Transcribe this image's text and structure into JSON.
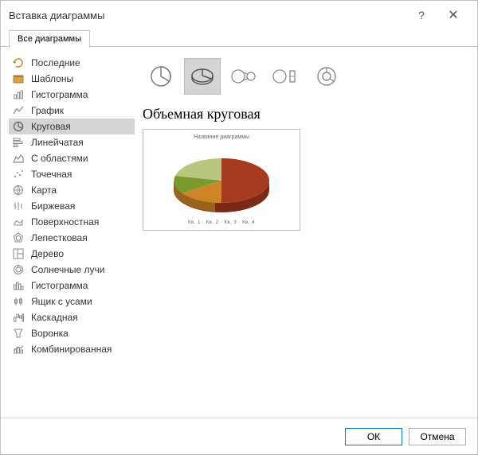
{
  "dialog": {
    "title": "Вставка диаграммы"
  },
  "tab": {
    "label": "Все диаграммы"
  },
  "sidebar": {
    "items": [
      {
        "label": "Последние",
        "icon": "recent-icon"
      },
      {
        "label": "Шаблоны",
        "icon": "templates-icon"
      },
      {
        "label": "Гистограмма",
        "icon": "column-chart-icon"
      },
      {
        "label": "График",
        "icon": "line-chart-icon"
      },
      {
        "label": "Круговая",
        "icon": "pie-chart-icon",
        "selected": true
      },
      {
        "label": "Линейчатая",
        "icon": "bar-chart-icon"
      },
      {
        "label": "С областями",
        "icon": "area-chart-icon"
      },
      {
        "label": "Точечная",
        "icon": "scatter-chart-icon"
      },
      {
        "label": "Карта",
        "icon": "map-chart-icon"
      },
      {
        "label": "Биржевая",
        "icon": "stock-chart-icon"
      },
      {
        "label": "Поверхностная",
        "icon": "surface-chart-icon"
      },
      {
        "label": "Лепестковая",
        "icon": "radar-chart-icon"
      },
      {
        "label": "Дерево",
        "icon": "treemap-chart-icon"
      },
      {
        "label": "Солнечные лучи",
        "icon": "sunburst-chart-icon"
      },
      {
        "label": "Гистограмма",
        "icon": "histogram-chart-icon"
      },
      {
        "label": "Ящик с усами",
        "icon": "boxwhisker-chart-icon"
      },
      {
        "label": "Каскадная",
        "icon": "waterfall-chart-icon"
      },
      {
        "label": "Воронка",
        "icon": "funnel-chart-icon"
      },
      {
        "label": "Комбинированная",
        "icon": "combo-chart-icon"
      }
    ]
  },
  "subtype": {
    "selected_index": 1,
    "title": "Объемная круговая"
  },
  "preview": {
    "title": "Название диаграммы",
    "legend": "Кв. 1 · Кв. 2 · Кв. 3 · Кв. 4"
  },
  "footer": {
    "ok": "ОК",
    "cancel": "Отмена"
  },
  "chart_data": {
    "type": "pie",
    "title": "Название диаграммы",
    "categories": [
      "Кв. 1",
      "Кв. 2",
      "Кв. 3",
      "Кв. 4"
    ],
    "values": [
      50,
      25,
      15,
      10
    ],
    "colors": [
      "#a63a1f",
      "#ce8326",
      "#7a9a2f",
      "#b8c77d"
    ],
    "style": "3D"
  }
}
